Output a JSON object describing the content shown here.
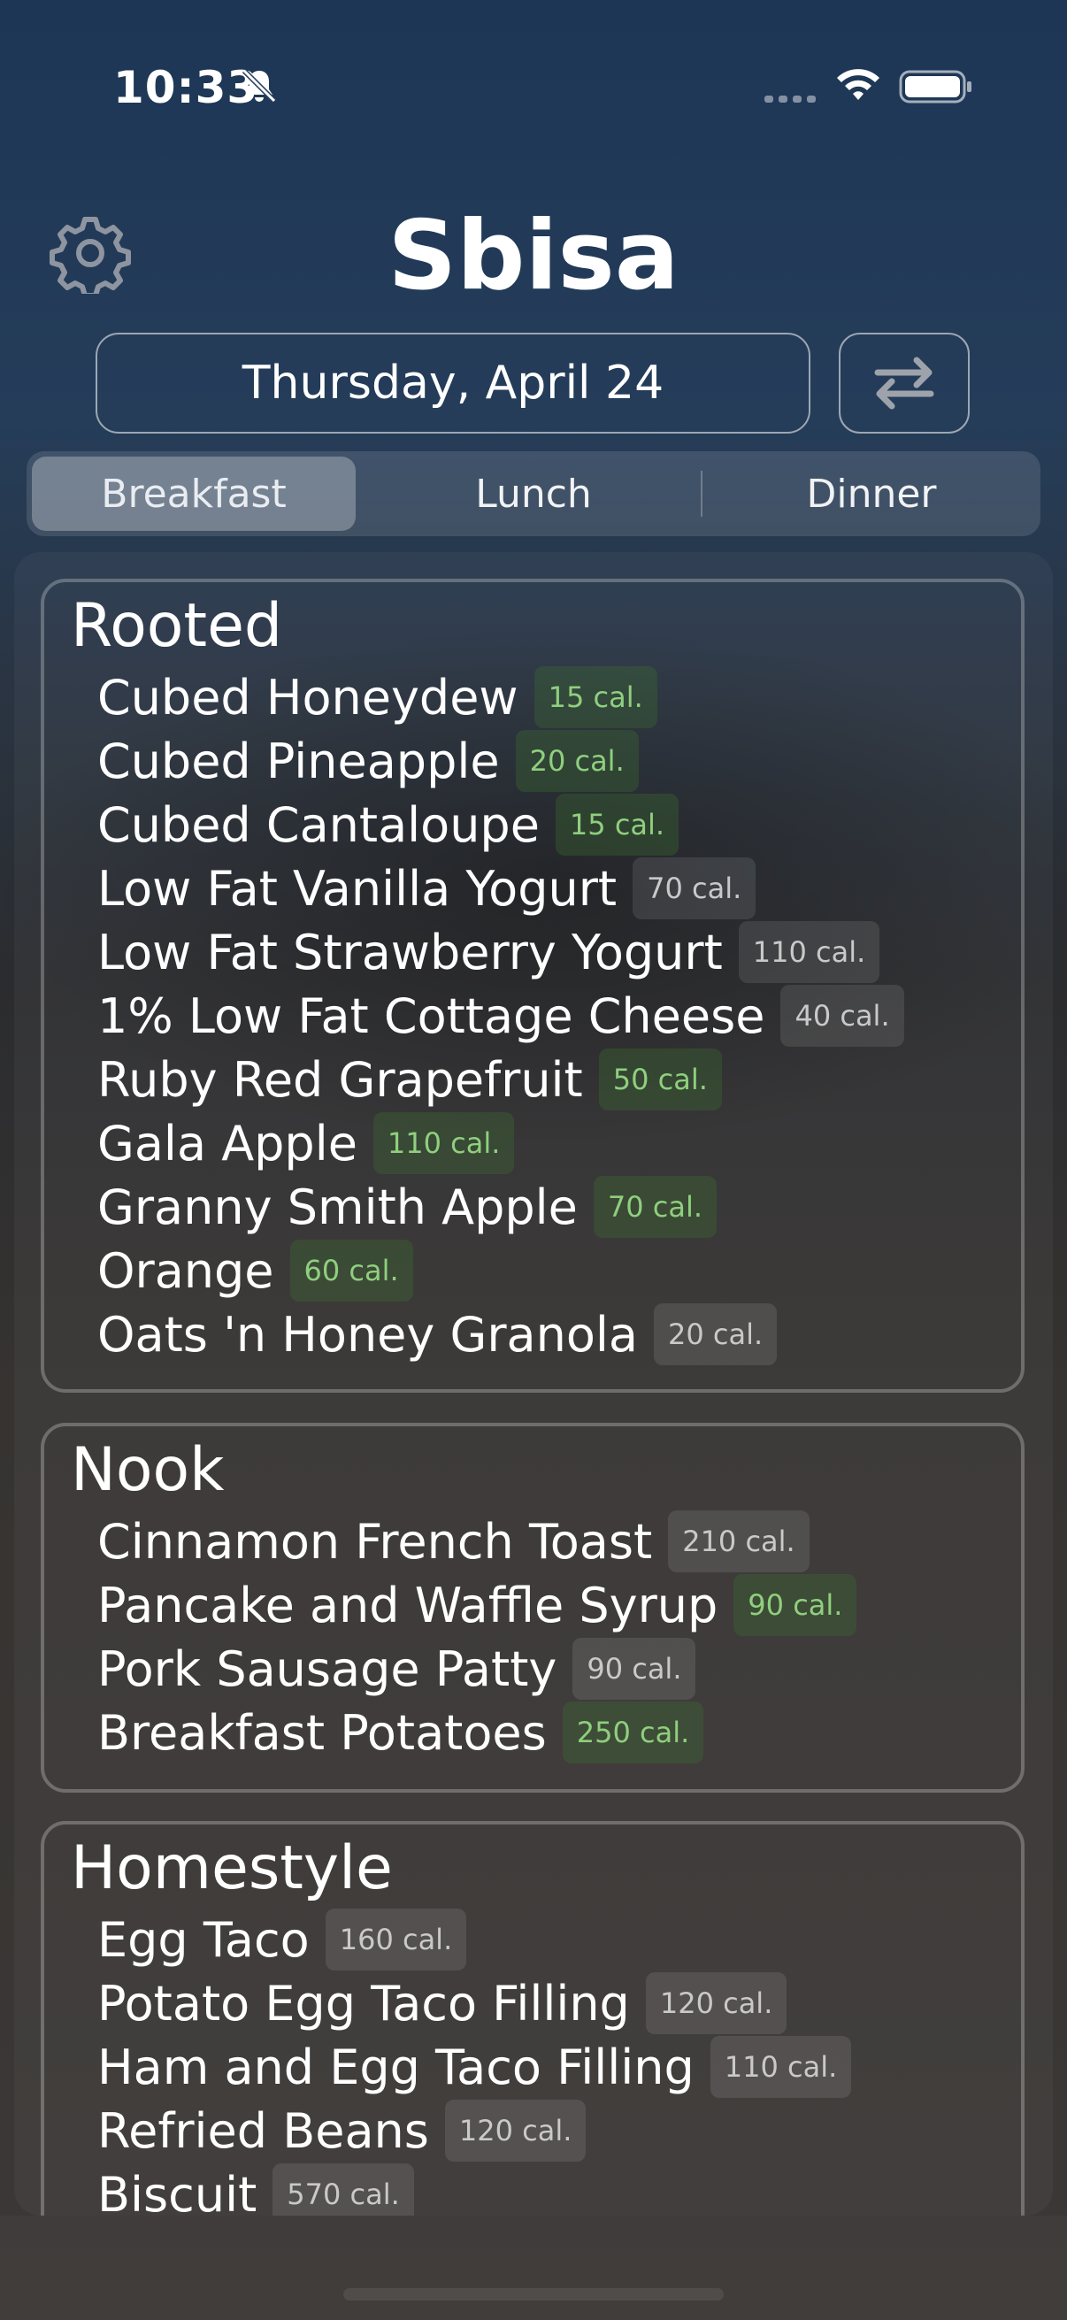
{
  "status_bar": {
    "time": "10:33",
    "icons": [
      "bell-slash-icon",
      "cellular-dots-icon",
      "wifi-icon",
      "battery-icon"
    ]
  },
  "header": {
    "title": "Sbisa",
    "settings_icon": "gear-icon",
    "date": "Thursday, April 24",
    "swap_icon": "arrows-swap-icon"
  },
  "meal_tabs": [
    {
      "label": "Breakfast",
      "selected": true
    },
    {
      "label": "Lunch",
      "selected": false
    },
    {
      "label": "Dinner",
      "selected": false
    }
  ],
  "stations": [
    {
      "name": "Rooted",
      "items": [
        {
          "name": "Cubed Honeydew",
          "calories": "15 cal.",
          "tag": "green"
        },
        {
          "name": "Cubed Pineapple",
          "calories": "20 cal.",
          "tag": "green"
        },
        {
          "name": "Cubed Cantaloupe",
          "calories": "15 cal.",
          "tag": "green"
        },
        {
          "name": "Low Fat Vanilla Yogurt",
          "calories": "70 cal.",
          "tag": "gray"
        },
        {
          "name": "Low Fat Strawberry Yogurt",
          "calories": "110 cal.",
          "tag": "gray"
        },
        {
          "name": "1% Low Fat Cottage Cheese",
          "calories": "40 cal.",
          "tag": "gray"
        },
        {
          "name": "Ruby Red Grapefruit",
          "calories": "50 cal.",
          "tag": "green"
        },
        {
          "name": "Gala Apple",
          "calories": "110 cal.",
          "tag": "green"
        },
        {
          "name": "Granny Smith Apple",
          "calories": "70 cal.",
          "tag": "green"
        },
        {
          "name": "Orange",
          "calories": "60 cal.",
          "tag": "green"
        },
        {
          "name": "Oats 'n Honey Granola",
          "calories": "20 cal.",
          "tag": "gray"
        }
      ]
    },
    {
      "name": "Nook",
      "items": [
        {
          "name": "Cinnamon French Toast",
          "calories": "210 cal.",
          "tag": "gray"
        },
        {
          "name": "Pancake and Waffle Syrup",
          "calories": "90 cal.",
          "tag": "green"
        },
        {
          "name": "Pork Sausage Patty",
          "calories": "90 cal.",
          "tag": "gray"
        },
        {
          "name": "Breakfast Potatoes",
          "calories": "250 cal.",
          "tag": "green"
        }
      ]
    },
    {
      "name": "Homestyle",
      "items": [
        {
          "name": "Egg Taco",
          "calories": "160 cal.",
          "tag": "gray"
        },
        {
          "name": "Potato Egg Taco Filling",
          "calories": "120 cal.",
          "tag": "gray"
        },
        {
          "name": "Ham and Egg Taco Filling",
          "calories": "110 cal.",
          "tag": "gray"
        },
        {
          "name": "Refried Beans",
          "calories": "120 cal.",
          "tag": "gray"
        },
        {
          "name": "Biscuit",
          "calories": "570 cal.",
          "tag": "gray"
        }
      ]
    }
  ]
}
